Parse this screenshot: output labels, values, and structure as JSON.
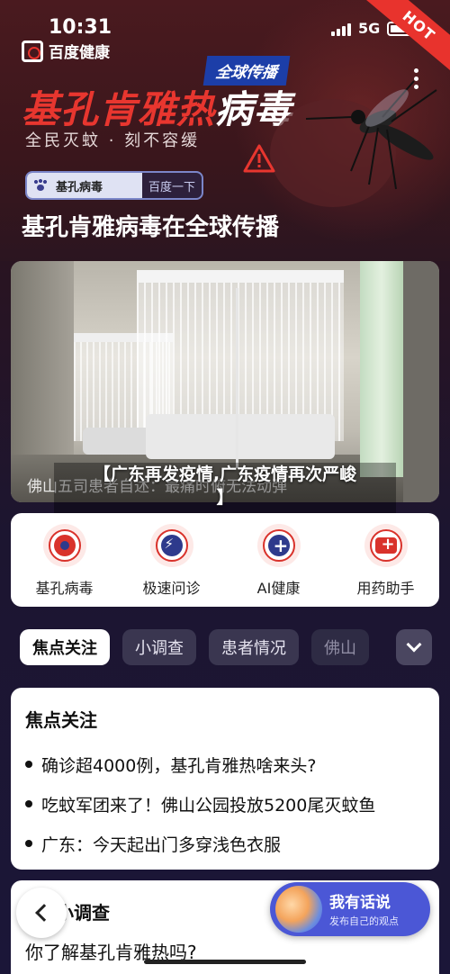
{
  "status_bar": {
    "time": "10:31",
    "network": "5G"
  },
  "hero": {
    "hot_badge": "HOT",
    "brand": "百度健康",
    "tag": "全球传播",
    "title_red": "基孔肯雅热",
    "title_white": "病毒",
    "subtitle": "全民灭蚊 · 刻不容缓",
    "search_value": "基孔病毒",
    "search_button": "百度一下"
  },
  "main_title": "基孔肯雅病毒在全球传播",
  "video": {
    "caption": "佛山五司患者自述：最痛时俯无法动弹",
    "overlay_line1": "【广东再发疫情,广东疫情再次严峻",
    "overlay_line2": "】"
  },
  "services": [
    {
      "label": "基孔病毒",
      "icon": "virus-icon"
    },
    {
      "label": "极速问诊",
      "icon": "lightning-icon"
    },
    {
      "label": "AI健康",
      "icon": "doctor-icon"
    },
    {
      "label": "用药助手",
      "icon": "medkit-icon"
    }
  ],
  "tabs": [
    "焦点关注",
    "小调查",
    "患者情况",
    "佛山"
  ],
  "focus": {
    "title": "焦点关注",
    "items": [
      "确诊超4000例，基孔肯雅热啥来头?",
      "吃蚊军团来了！佛山公园投放5200尾灭蚊鱼",
      "广东：今天起出门多穿浅色衣服"
    ]
  },
  "survey": {
    "title": "小调查",
    "question": "你了解基孔肯雅热吗?"
  },
  "talk": {
    "title": "我有话说",
    "subtitle": "发布自己的观点"
  },
  "colors": {
    "brand_red": "#e8362f",
    "accent_blue": "#4b57d6",
    "tag_blue": "#1c3ea8"
  }
}
